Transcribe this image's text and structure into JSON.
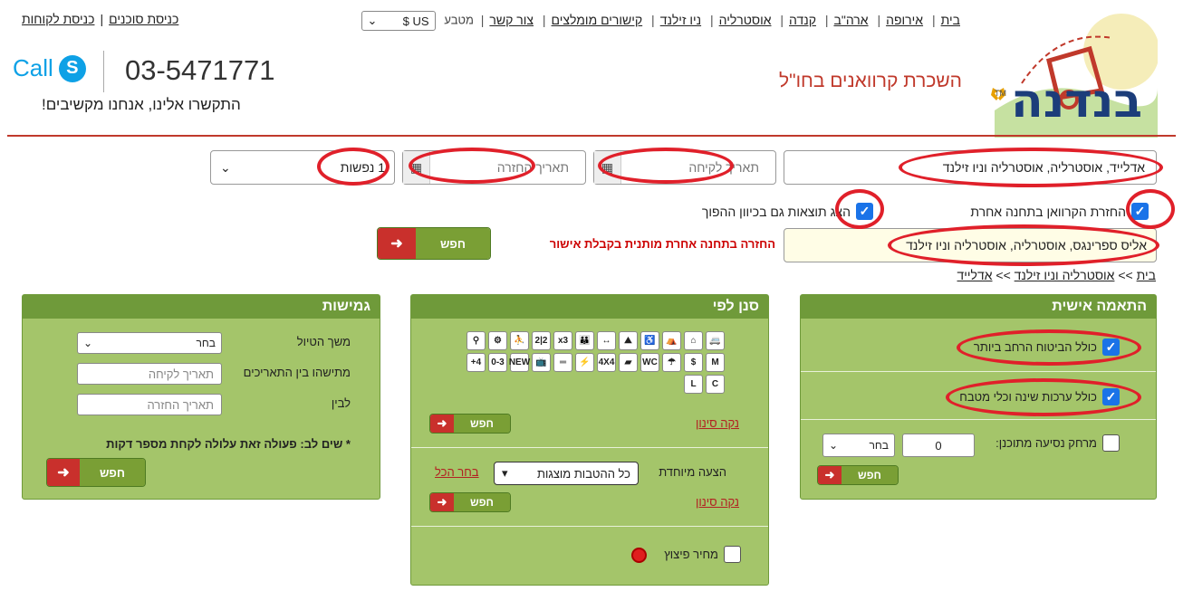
{
  "nav": {
    "items": [
      "בית",
      "אירופה",
      "ארה\"ב",
      "קנדה",
      "אוסטרליה",
      "ניו זילנד",
      "קישורים מומלצים",
      "צור קשר"
    ],
    "currency_label": "מטבע",
    "currency_value": "US $"
  },
  "login": {
    "agents": "כניסת סוכנים",
    "customers": "כניסת לקוחות"
  },
  "logo": {
    "text": "בנדנה",
    "tm": "TM"
  },
  "tagline": "השכרת קרוואנים בחו\"ל",
  "contact": {
    "skype_label": "Call",
    "phone": "03-5471771",
    "call_us": "התקשרו אלינו, אנחנו מקשיבים!"
  },
  "search": {
    "location": "אדלייד, אוסטרליה, אוסטרליה וניו זילנד",
    "pickup_placeholder": "תאריך לקיחה",
    "return_placeholder": "תאריך החזרה",
    "passengers": "1 נפשות",
    "return_other_station": "החזרת הקרוואן בתחנה אחרת",
    "show_reverse": "הצג תוצאות גם בכיוון ההפוך",
    "return_location": "אליס ספרינגס, אוסטרליה, אוסטרליה וניו זילנד",
    "return_warning": "החזרה בתחנה אחרת מותנית בקבלת אישור",
    "search_button": "חפש"
  },
  "breadcrumb": {
    "home": "בית",
    "region": "אוסטרליה וניו זילנד",
    "city": "אדלייד"
  },
  "personal": {
    "title": "התאמה אישית",
    "full_insurance": "כולל הביטוח הרחב ביותר",
    "bedding_kitchen": "כולל ערכות שינה וכלי מטבח",
    "distance_label": "מרחק נסיעה מתוכנן:",
    "distance_value": "0",
    "distance_select": "בחר",
    "search_button": "חפש"
  },
  "filter": {
    "title": "סנן לפי",
    "icons": [
      {
        "name": "child-seat-icon",
        "glyph": "⚲"
      },
      {
        "name": "gear-icon",
        "glyph": "⚙"
      },
      {
        "name": "shower-person-icon",
        "glyph": "⛹"
      },
      {
        "name": "two-plus-two-icon",
        "glyph": "2|2"
      },
      {
        "name": "times-three-icon",
        "glyph": "x3"
      },
      {
        "name": "family-icon",
        "glyph": "👪"
      },
      {
        "name": "length-icon",
        "glyph": "↔"
      },
      {
        "name": "mountain-icon",
        "glyph": "⛰"
      },
      {
        "name": "wheelchair-icon",
        "glyph": "♿"
      },
      {
        "name": "camper-pole-icon",
        "glyph": "⛺"
      },
      {
        "name": "camper-awning-icon",
        "glyph": "⌂"
      },
      {
        "name": "van-icon",
        "glyph": "🚐"
      },
      {
        "name": "plus-four-icon",
        "glyph": "+4"
      },
      {
        "name": "age-range-icon",
        "glyph": "0-3"
      },
      {
        "name": "new-icon",
        "glyph": "NEW"
      },
      {
        "name": "tv-icon",
        "glyph": "📺"
      },
      {
        "name": "bed-icon",
        "glyph": "═"
      },
      {
        "name": "electric-icon",
        "glyph": "⚡"
      },
      {
        "name": "four-by-four-icon",
        "glyph": "4X4"
      },
      {
        "name": "side-van-icon",
        "glyph": "▰"
      },
      {
        "name": "wc-icon",
        "glyph": "WC"
      },
      {
        "name": "shower-icon",
        "glyph": "☂"
      },
      {
        "name": "dollar-camper-icon",
        "glyph": "$"
      },
      {
        "name": "medium-camper-icon",
        "glyph": "M"
      },
      {
        "name": "large-camper-icon",
        "glyph": "L"
      },
      {
        "name": "compact-search-icon",
        "glyph": "C"
      }
    ],
    "clear": "נקה סינון",
    "search_button": "חפש",
    "special_offer_label": "הצעה מיוחדת",
    "special_offer_value": "כל ההטבות מוצגות",
    "select_all": "בחר הכל",
    "clear2": "נקה סינון",
    "search_button2": "חפש",
    "compensation_price": "מחיר פיצוץ"
  },
  "flex": {
    "title": "גמישות",
    "duration_label": "משך הטיול",
    "duration_select": "בחר",
    "range_label": "מתישהו בין התאריכים",
    "pickup_placeholder": "תאריך לקיחה",
    "and_label": "לבין",
    "return_placeholder": "תאריך החזרה",
    "note": "* שים לב: פעולה זאת עלולה לקחת מספר דקות",
    "search_button": "חפש"
  }
}
